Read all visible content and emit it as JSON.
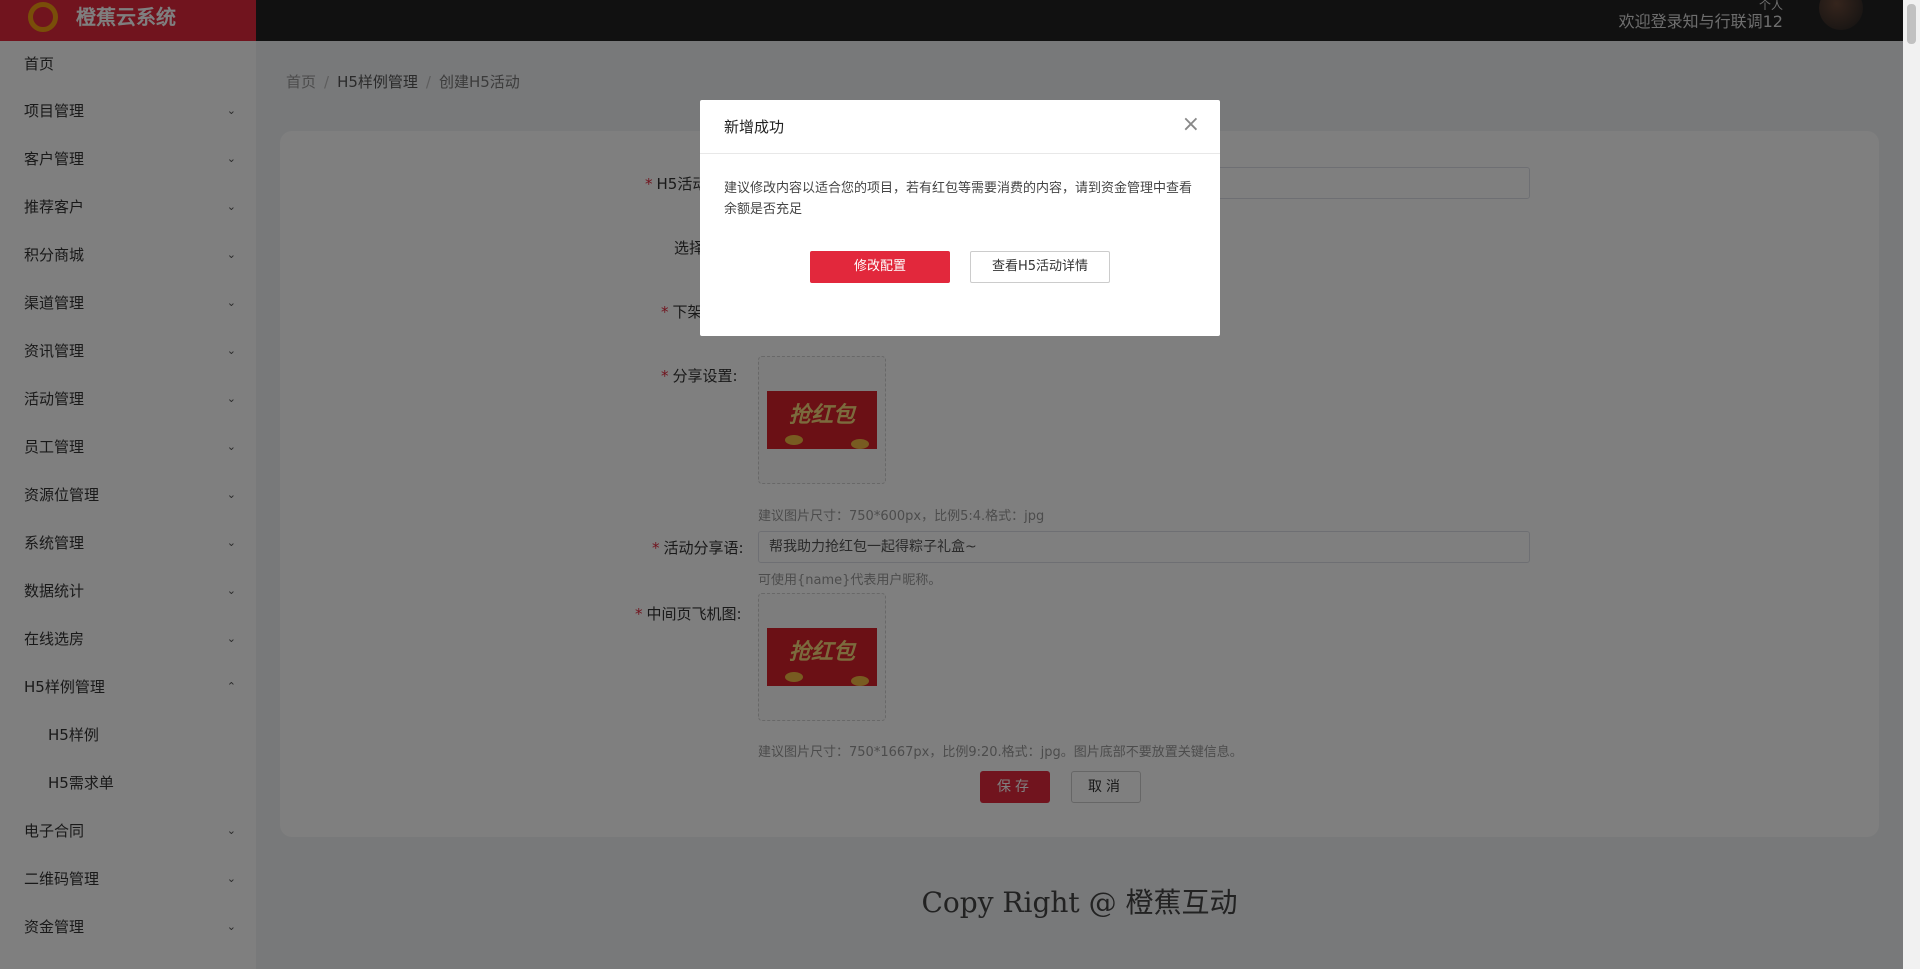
{
  "app": {
    "name": "橙蕉云系统",
    "welcome": "欢迎登录知与行联调12",
    "top_small": "个人"
  },
  "sidebar": {
    "items": [
      {
        "label": "首页",
        "chevron": ""
      },
      {
        "label": "项目管理",
        "chevron": "⌄"
      },
      {
        "label": "客户管理",
        "chevron": "⌄"
      },
      {
        "label": "推荐客户",
        "chevron": "⌄"
      },
      {
        "label": "积分商城",
        "chevron": "⌄"
      },
      {
        "label": "渠道管理",
        "chevron": "⌄"
      },
      {
        "label": "资讯管理",
        "chevron": "⌄"
      },
      {
        "label": "活动管理",
        "chevron": "⌄"
      },
      {
        "label": "员工管理",
        "chevron": "⌄"
      },
      {
        "label": "资源位管理",
        "chevron": "⌄"
      },
      {
        "label": "系统管理",
        "chevron": "⌄"
      },
      {
        "label": "数据统计",
        "chevron": "⌄"
      },
      {
        "label": "在线选房",
        "chevron": "⌄"
      },
      {
        "label": "H5样例管理",
        "chevron": "⌃"
      },
      {
        "label": "H5样例",
        "chevron": ""
      },
      {
        "label": "H5需求单",
        "chevron": ""
      },
      {
        "label": "电子合同",
        "chevron": "⌄"
      },
      {
        "label": "二维码管理",
        "chevron": "⌄"
      },
      {
        "label": "资金管理",
        "chevron": "⌄"
      }
    ]
  },
  "breadcrumb": {
    "home": "首页",
    "section": "H5样例管理",
    "current": "创建H5活动",
    "sep": "/"
  },
  "form": {
    "h5_name_label": "H5活动",
    "select_label": "选择",
    "download_label": "下架",
    "share_label": "分享设置:",
    "share_image_text": "抢红包",
    "share_hint": "建议图片尺寸：750*600px，比例5:4.格式：jpg",
    "slogan_label": "活动分享语:",
    "slogan_value": "帮我助力抢红包一起得粽子礼盒~",
    "slogan_hint": "可使用{name}代表用户昵称。",
    "mid_label": "中间页飞机图:",
    "mid_image_text": "抢红包",
    "mid_hint": "建议图片尺寸：750*1667px，比例9:20.格式：jpg。图片底部不要放置关键信息。",
    "save": "保存",
    "cancel": "取消"
  },
  "footer": {
    "text": "Copy Right @ 橙蕉互动"
  },
  "modal": {
    "title": "新增成功",
    "close": "×",
    "body": "建议修改内容以适合您的项目，若有红包等需要消费的内容，请到资金管理中查看余额是否充足",
    "primary": "修改配置",
    "secondary": "查看H5活动详情"
  },
  "colors": {
    "brand": "#e2283c",
    "topbar": "#222222",
    "accent_logo": "#f39c12"
  }
}
